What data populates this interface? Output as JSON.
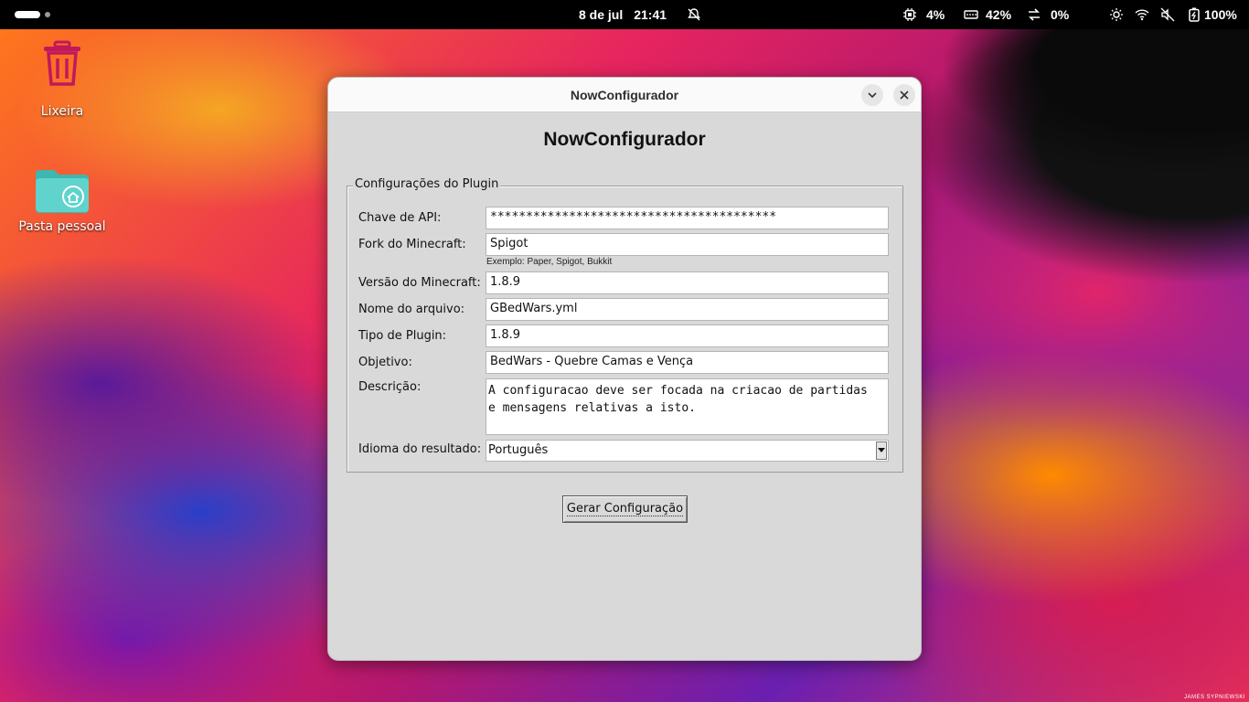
{
  "topbar": {
    "date": "8 de jul",
    "time": "21:41",
    "cpu": "4%",
    "memory": "42%",
    "network": "0%",
    "battery": "100%"
  },
  "desktop": {
    "trash_label": "Lixeira",
    "home_label": "Pasta pessoal"
  },
  "window": {
    "title": "NowConfigurador",
    "heading": "NowConfigurador",
    "group_title": "Configurações do Plugin",
    "fields": {
      "api_key": {
        "label": "Chave de API:",
        "value": "****************************************"
      },
      "fork": {
        "label": "Fork do Minecraft:",
        "value": "Spigot",
        "hint": "Exemplo: Paper, Spigot, Bukkit"
      },
      "version": {
        "label": "Versão do Minecraft:",
        "value": "1.8.9"
      },
      "filename": {
        "label": "Nome do arquivo:",
        "value": "GBedWars.yml"
      },
      "plugin_type": {
        "label": "Tipo de Plugin:",
        "value": "1.8.9"
      },
      "objective": {
        "label": "Objetivo:",
        "value": "BedWars - Quebre Camas e Vença"
      },
      "description": {
        "label": "Descrição:",
        "value": "A configuracao deve ser focada na criacao de partidas\ne mensagens relativas a isto."
      },
      "language": {
        "label": "Idioma do resultado:",
        "value": "Português"
      }
    },
    "generate_button": "Gerar Configuração"
  },
  "wallpaper_credit": "JAMES SYPNIEWSKI"
}
